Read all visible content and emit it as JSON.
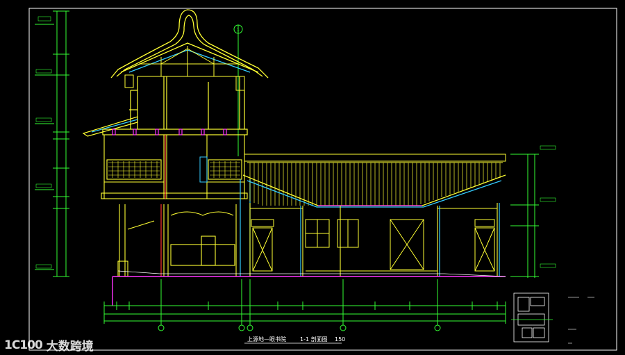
{
  "drawing": {
    "title": "上源地—眼书院",
    "section_label": "1-1 剖面图",
    "scale": "150",
    "section_marker": "1",
    "colors": {
      "background": "#000000",
      "frame": "#ffffff",
      "structure": "#ffff33",
      "dimension": "#33ff33",
      "accent_magenta": "#ff33ff",
      "accent_cyan": "#33ccff",
      "accent_red": "#ff3333"
    }
  },
  "watermark": {
    "mark": "1C100",
    "text": "大数跨境"
  }
}
